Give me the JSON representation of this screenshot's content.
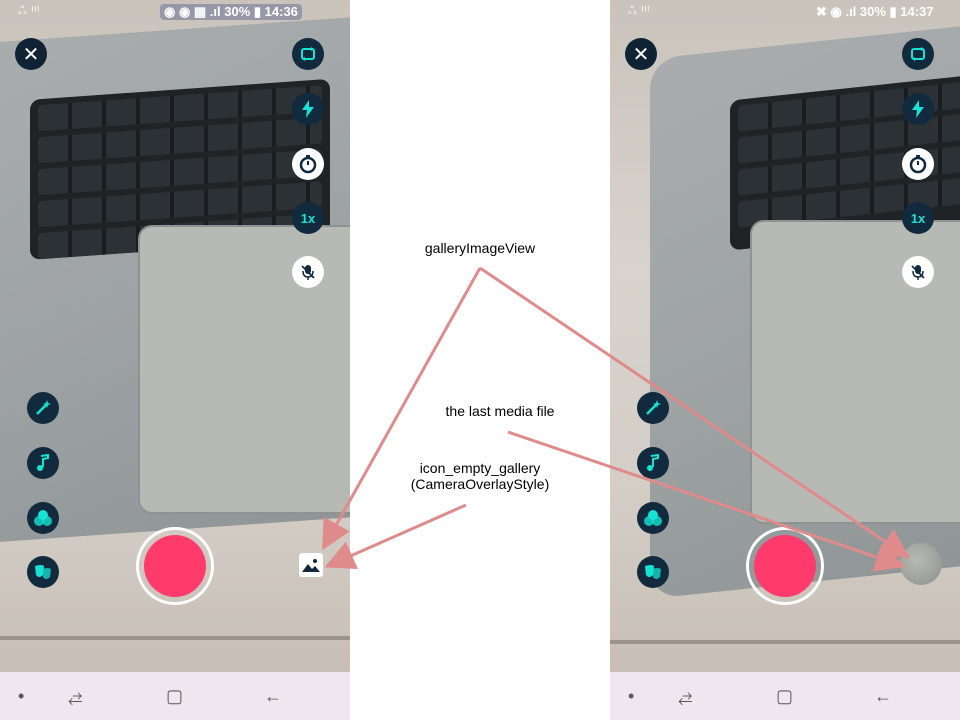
{
  "annotations": {
    "gallery_image_view": "galleryImageView",
    "last_media_file": "the last media file",
    "empty_gallery_line1": "icon_empty_gallery",
    "empty_gallery_line2": "(CameraOverlayStyle)",
    "arrow_color": "#e08b8b"
  },
  "left_phone": {
    "status": {
      "left": "ஃ ᴵᴵˡ",
      "right": "◉ ◉ ▦ .ıl 30% ▮ 14:36"
    },
    "zoom_label": "1x"
  },
  "right_phone": {
    "status": {
      "left": "ஃ ᴵᴵˡ",
      "right": "✖ ◉ .ıl 30% ▮ 14:37"
    },
    "zoom_label": "1x"
  },
  "colors": {
    "record": "#ff3b6b",
    "control_bg": "#112a3d",
    "control_icon": "#16e3d3",
    "navbar_bg": "#efe6ef"
  },
  "icons": [
    "close-icon",
    "switch-camera-icon",
    "flash-icon",
    "timer-icon",
    "mic-off-icon",
    "magic-wand-icon",
    "music-note-icon",
    "filters-icon",
    "masks-icon",
    "empty-gallery-icon",
    "record-icon"
  ]
}
